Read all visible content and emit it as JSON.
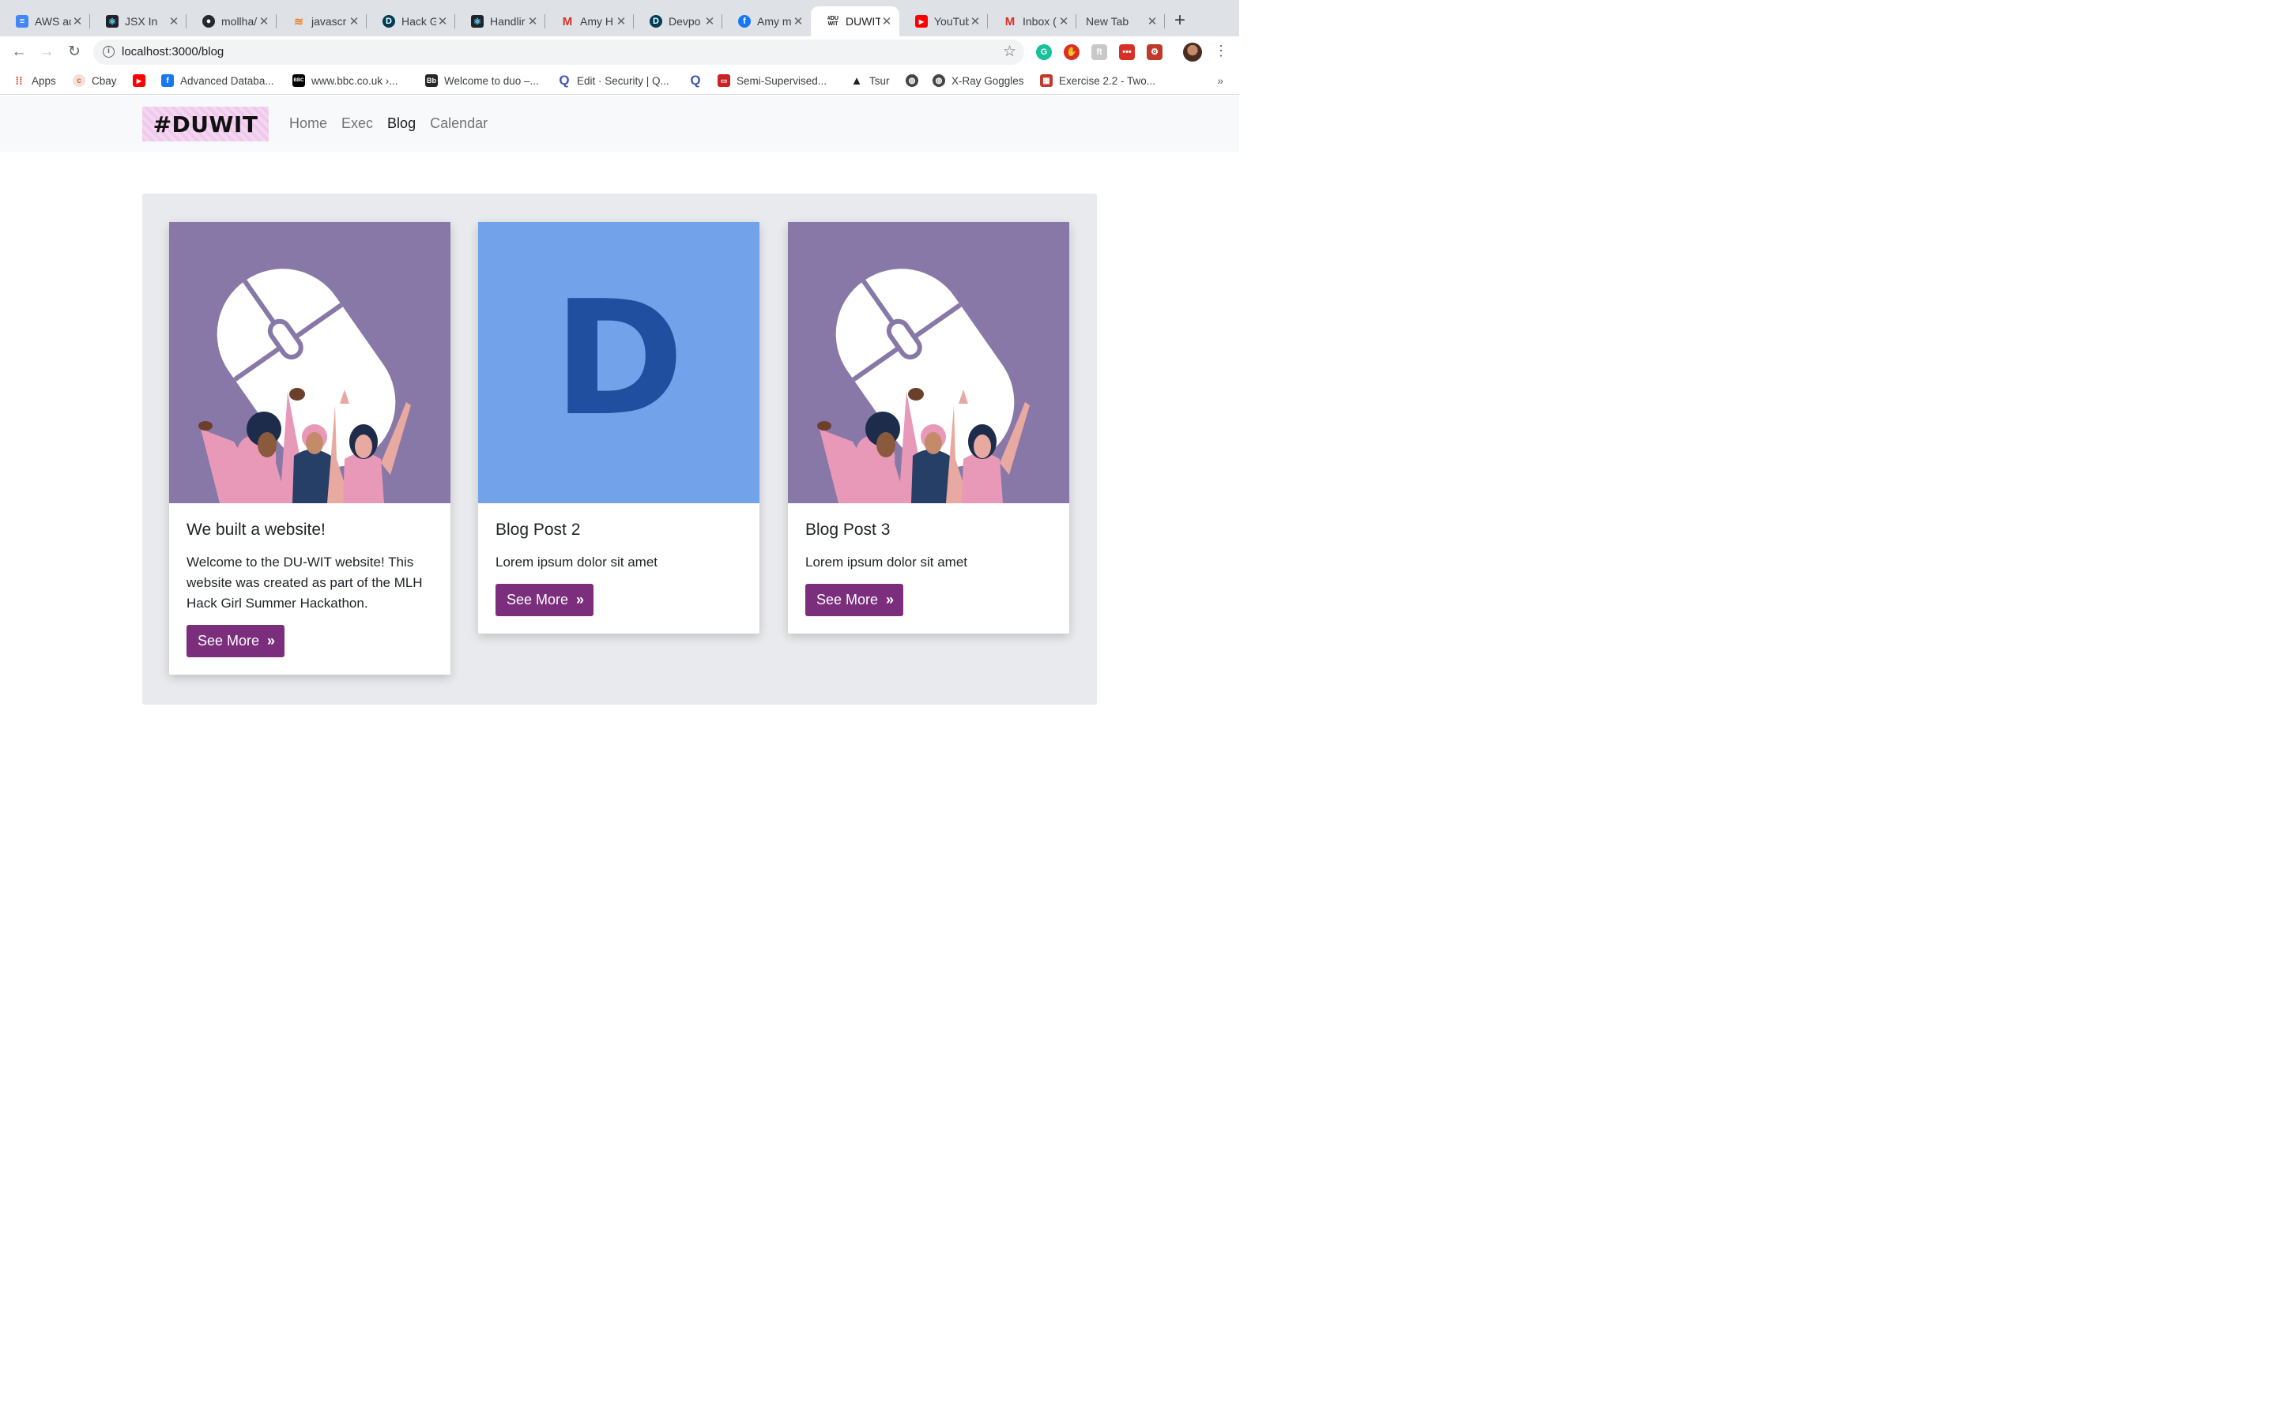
{
  "browser": {
    "tabs": [
      {
        "title": "AWS ac",
        "icon": "google-docs-icon",
        "color": "#4285f4"
      },
      {
        "title": "JSX In",
        "icon": "react-icon",
        "color": "#20232a"
      },
      {
        "title": "mollha/",
        "icon": "github-icon",
        "color": "#24292e"
      },
      {
        "title": "javascr",
        "icon": "stackoverflow-icon",
        "color": "#f48024"
      },
      {
        "title": "Hack G",
        "icon": "devpost-icon",
        "color": "#003e54"
      },
      {
        "title": "Handlir",
        "icon": "react-icon",
        "color": "#20232a"
      },
      {
        "title": "Amy H",
        "icon": "gmail-icon",
        "color": "#d93025"
      },
      {
        "title": "Devpo",
        "icon": "devpost-icon",
        "color": "#003e54"
      },
      {
        "title": "Amy m",
        "icon": "facebook-icon",
        "color": "#1877f2"
      },
      {
        "title": "DUWIT",
        "icon": "duwit-icon",
        "color": "#111111",
        "active": true
      },
      {
        "title": "YouTub",
        "icon": "youtube-icon",
        "color": "#ff0000"
      },
      {
        "title": "Inbox (",
        "icon": "gmail-icon",
        "color": "#d93025"
      },
      {
        "title": "New Tab",
        "icon": "",
        "color": ""
      }
    ],
    "url": "localhost:3000/blog",
    "bookmarks": [
      {
        "label": "Apps",
        "icon": "apps-grid-icon",
        "color": "#ea4335"
      },
      {
        "label": "Cbay",
        "icon": "cbay-icon",
        "color": "#e8603c"
      },
      {
        "label": "",
        "icon": "youtube-icon",
        "color": "#ff0000"
      },
      {
        "label": "Advanced Databa...",
        "icon": "facebook-icon",
        "color": "#1877f2"
      },
      {
        "label": "www.bbc.co.uk ›...",
        "icon": "bbc-icon",
        "color": "#000000"
      },
      {
        "label": "Welcome to duo –...",
        "icon": "blackboard-icon",
        "color": "#262626"
      },
      {
        "label": "Edit · Security | Q...",
        "icon": "quizlet-icon",
        "color": "#4257b2"
      },
      {
        "label": "",
        "icon": "quizlet-icon",
        "color": "#4257b2"
      },
      {
        "label": "Semi-Supervised...",
        "icon": "paper-icon",
        "color": "#cc2222"
      },
      {
        "label": "Tsur",
        "icon": "tsur-icon",
        "color": "#222222"
      },
      {
        "label": "",
        "icon": "globe-icon",
        "color": "#444444"
      },
      {
        "label": "X-Ray Goggles",
        "icon": "globe-icon",
        "color": "#444444"
      },
      {
        "label": "Exercise 2.2 - Two...",
        "icon": "exercise-icon",
        "color": "#c0392b"
      }
    ],
    "bookmarks_more": "»"
  },
  "site": {
    "logo_text": "#DUWIT",
    "nav": [
      {
        "label": "Home",
        "active": false
      },
      {
        "label": "Exec",
        "active": false
      },
      {
        "label": "Blog",
        "active": true
      },
      {
        "label": "Calendar",
        "active": false
      }
    ],
    "accent_color": "#7a2e7c",
    "posts": [
      {
        "title": "We built a website!",
        "text": "Welcome to the DU-WIT website! This website was created as part of the MLH Hack Girl Summer Hackathon.",
        "button": "See More",
        "image": "women-celebrating-mouse-illustration"
      },
      {
        "title": "Blog Post 2",
        "text": "Lorem ipsum dolor sit amet",
        "button": "See More",
        "image": "letter-d-logo",
        "image_letter": "D"
      },
      {
        "title": "Blog Post 3",
        "text": "Lorem ipsum dolor sit amet",
        "button": "See More",
        "image": "women-celebrating-mouse-illustration"
      }
    ]
  }
}
